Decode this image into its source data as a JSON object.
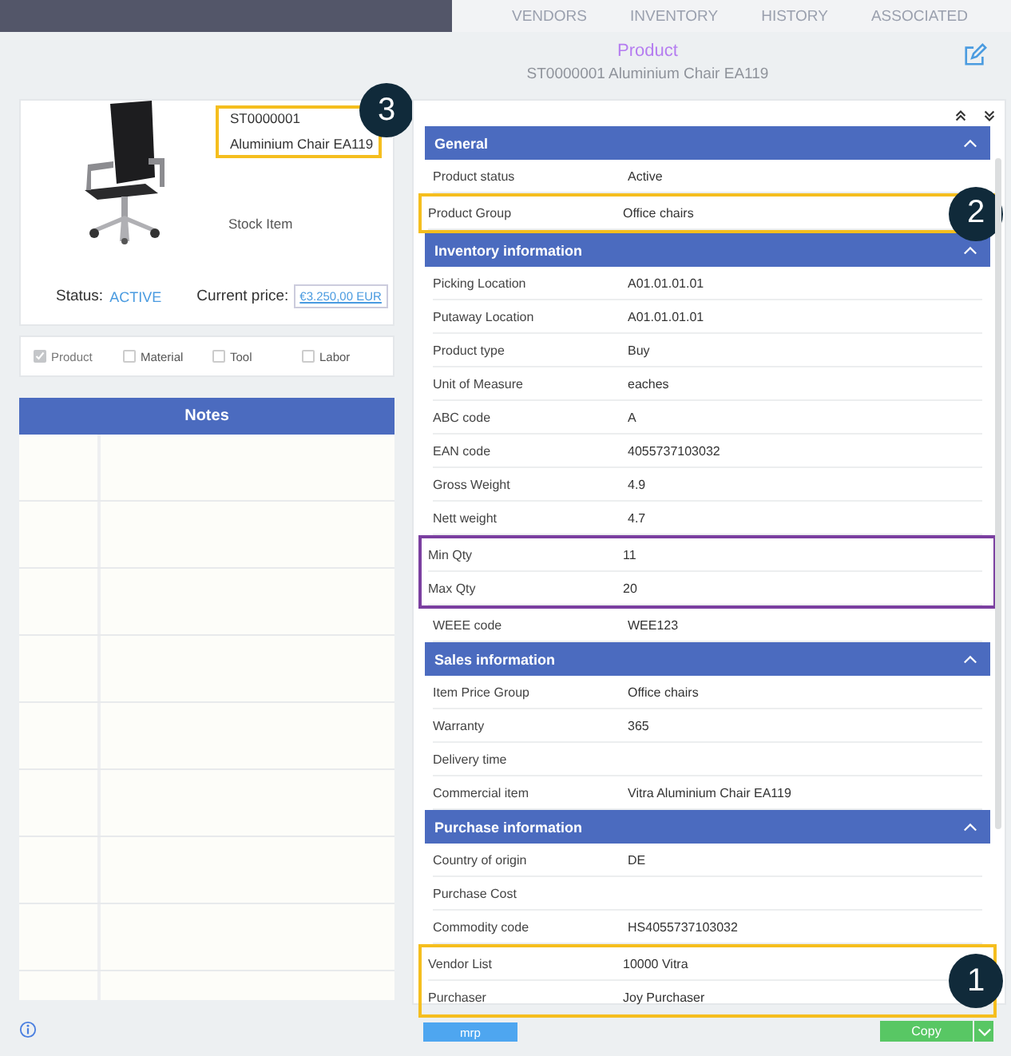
{
  "tabs": [
    {
      "label": "VENDORS",
      "selected": false
    },
    {
      "label": "INVENTORY",
      "selected": false
    },
    {
      "label": "HISTORY",
      "selected": false
    },
    {
      "label": "ASSOCIATED",
      "selected": false
    }
  ],
  "header": {
    "title": "Product",
    "subtitle": "ST0000001 Aluminium Chair EA119"
  },
  "product": {
    "code": "ST0000001",
    "name": "Aluminium Chair EA119",
    "badge": "3",
    "stock_type": "Stock Item",
    "status_label": "Status:",
    "status": "ACTIVE",
    "price_label": "Current price:",
    "price": "€3.250,00 EUR"
  },
  "types": [
    {
      "label": "Product",
      "checked": true,
      "disabled": true
    },
    {
      "label": "Material",
      "checked": false,
      "disabled": false
    },
    {
      "label": "Tool",
      "checked": false,
      "disabled": false
    },
    {
      "label": "Labor",
      "checked": false,
      "disabled": false
    }
  ],
  "notes": {
    "title": "Notes"
  },
  "sections": [
    {
      "title": "General",
      "expanded": true,
      "items": [
        {
          "kind": "row",
          "label": "Product status",
          "value": "Active"
        },
        {
          "kind": "frame",
          "color": "#f5be1e",
          "badge": "2",
          "rows": [
            {
              "label": "Product Group",
              "value": "Office chairs"
            }
          ]
        }
      ]
    },
    {
      "title": "Inventory information",
      "expanded": true,
      "items": [
        {
          "kind": "row",
          "label": "Picking Location",
          "value": "A01.01.01.01"
        },
        {
          "kind": "row",
          "label": "Putaway Location",
          "value": "A01.01.01.01"
        },
        {
          "kind": "row",
          "label": "Product type",
          "value": "Buy"
        },
        {
          "kind": "row",
          "label": "Unit of Measure",
          "value": "eaches"
        },
        {
          "kind": "row",
          "label": "ABC code",
          "value": "A"
        },
        {
          "kind": "row",
          "label": "EAN code",
          "value": "4055737103032"
        },
        {
          "kind": "row",
          "label": "Gross Weight",
          "value": "4.9"
        },
        {
          "kind": "row",
          "label": "Nett weight",
          "value": "4.7"
        },
        {
          "kind": "frame",
          "color": "#7b3fa0",
          "rows": [
            {
              "label": "Min Qty",
              "value": "11"
            },
            {
              "label": "Max Qty",
              "value": "20"
            }
          ]
        },
        {
          "kind": "row",
          "label": "WEEE code",
          "value": "WEE123"
        }
      ]
    },
    {
      "title": "Sales information",
      "expanded": true,
      "items": [
        {
          "kind": "row",
          "label": "Item Price Group",
          "value": "Office chairs"
        },
        {
          "kind": "row",
          "label": "Warranty",
          "value": "365"
        },
        {
          "kind": "row",
          "label": "Delivery time"
        },
        {
          "kind": "row",
          "label": "Commercial item",
          "value": "Vitra Aluminium Chair EA119"
        }
      ]
    },
    {
      "title": "Purchase information",
      "expanded": true,
      "items": [
        {
          "kind": "row",
          "label": "Country of origin",
          "value": "DE"
        },
        {
          "kind": "row",
          "label": "Purchase Cost"
        },
        {
          "kind": "row",
          "label": "Commodity code",
          "value": "HS4055737103032"
        },
        {
          "kind": "frame",
          "color": "#f5be1e",
          "badge": "1",
          "rows": [
            {
              "label": "Vendor List",
              "value": "10000 Vitra"
            },
            {
              "label": "Purchaser",
              "value": "Joy Purchaser"
            }
          ]
        }
      ]
    }
  ],
  "footer": {
    "mrp": "mrp",
    "copy": "Copy"
  }
}
